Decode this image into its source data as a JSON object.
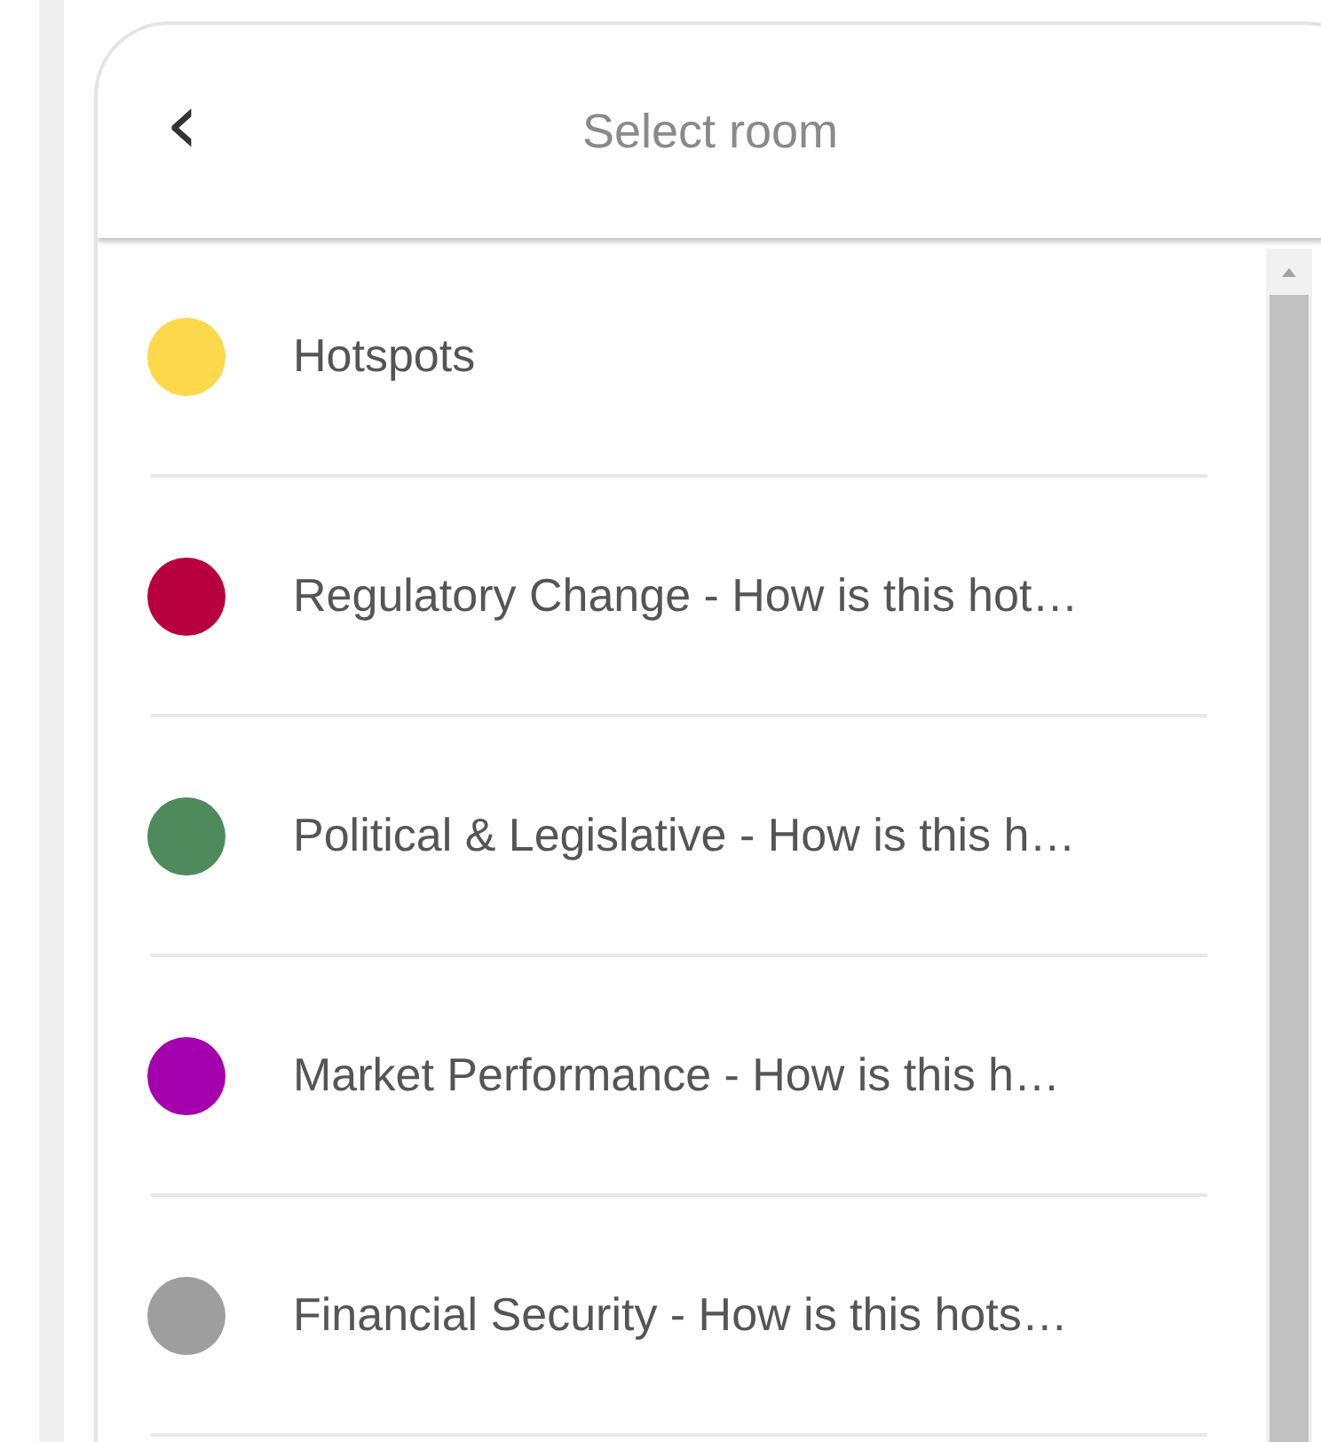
{
  "header": {
    "back_icon": "‹",
    "title": "Select room"
  },
  "rooms": [
    {
      "name": "Hotspots",
      "color": "#fdd84a"
    },
    {
      "name": "Regulatory Change - How is this hot…",
      "color": "#b8003f"
    },
    {
      "name": "Political & Legislative - How is this h…",
      "color": "#4f8a5c"
    },
    {
      "name": "Market Performance - How is this h…",
      "color": "#a400ad"
    },
    {
      "name": "Financial Security - How is this hots…",
      "color": "#9e9e9e"
    }
  ]
}
